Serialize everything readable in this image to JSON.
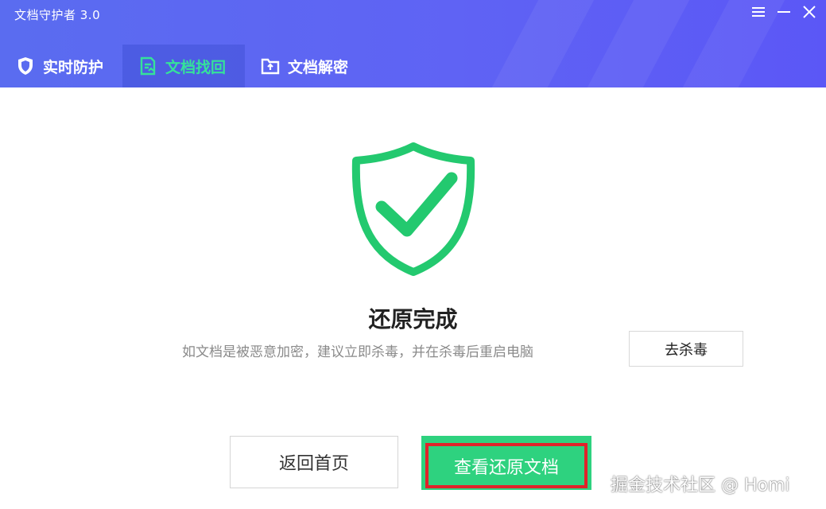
{
  "window": {
    "title": "文档守护者 3.0",
    "controls": {
      "menu_icon": "menu-icon",
      "minimize_icon": "minimize-icon",
      "close_icon": "close-icon"
    }
  },
  "tabs": [
    {
      "label": "实时防护",
      "icon": "shield-icon",
      "active": false
    },
    {
      "label": "文档找回",
      "icon": "document-recover-icon",
      "active": true
    },
    {
      "label": "文档解密",
      "icon": "folder-unlock-icon",
      "active": false
    }
  ],
  "result": {
    "icon": "shield-check-icon",
    "title": "还原完成",
    "hint": "如文档是被恶意加密，建议立即杀毒，并在杀毒后重启电脑",
    "kill_button": "去杀毒"
  },
  "actions": {
    "home_button": "返回首页",
    "view_button": "查看还原文档"
  },
  "watermark": "掘金技术社区 @ Homi",
  "colors": {
    "header_start": "#5a6cf0",
    "header_end": "#5b57f6",
    "accent_green": "#2ed27f",
    "active_tab_text": "#35e29a",
    "highlight_red": "#e0232a"
  }
}
